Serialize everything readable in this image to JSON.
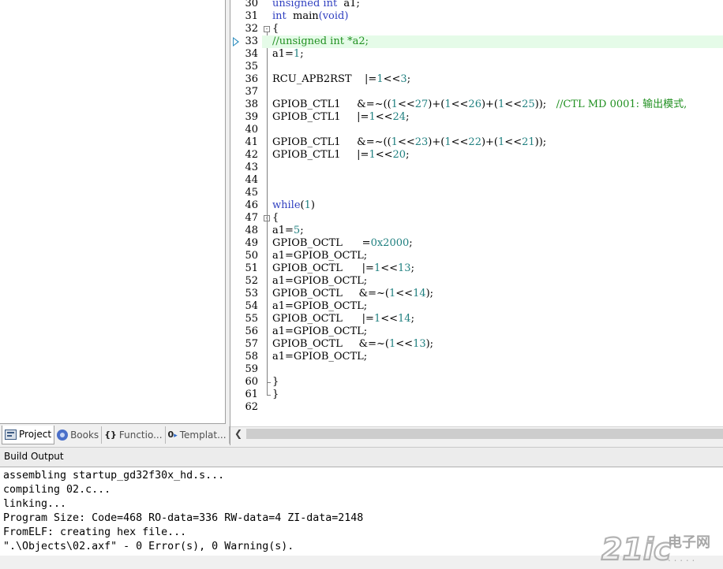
{
  "editor": {
    "lines": [
      {
        "n": "30",
        "segs": [
          [
            "kw",
            "unsigned int"
          ],
          [
            "",
            "  a1;"
          ]
        ]
      },
      {
        "n": "31",
        "segs": [
          [
            "kw",
            "int"
          ],
          [
            "",
            "  main"
          ],
          [
            "kw",
            "(void)"
          ]
        ]
      },
      {
        "n": "32",
        "segs": [
          [
            "",
            "{"
          ]
        ],
        "fold": "open"
      },
      {
        "n": "33",
        "segs": [
          [
            "cm",
            "//unsigned int *a2;"
          ]
        ],
        "highlight": true,
        "marker": true
      },
      {
        "n": "34",
        "segs": [
          [
            "",
            "a1="
          ],
          [
            "num",
            "1"
          ],
          [
            "",
            ";"
          ]
        ]
      },
      {
        "n": "35",
        "segs": []
      },
      {
        "n": "36",
        "segs": [
          [
            "",
            "RCU_APB2RST    |="
          ],
          [
            "num",
            "1"
          ],
          [
            "",
            "<<"
          ],
          [
            "num",
            "3"
          ],
          [
            "",
            ";"
          ]
        ]
      },
      {
        "n": "37",
        "segs": []
      },
      {
        "n": "38",
        "segs": [
          [
            "",
            "GPIOB_CTL1     &=~(("
          ],
          [
            "num",
            "1"
          ],
          [
            "",
            "<<"
          ],
          [
            "num",
            "27"
          ],
          [
            "",
            ")+("
          ],
          [
            "num",
            "1"
          ],
          [
            "",
            "<<"
          ],
          [
            "num",
            "26"
          ],
          [
            "",
            ")+("
          ],
          [
            "num",
            "1"
          ],
          [
            "",
            "<<"
          ],
          [
            "num",
            "25"
          ],
          [
            "",
            "));   "
          ],
          [
            "cm",
            "//CTL MD 0001: 输出模式,"
          ]
        ]
      },
      {
        "n": "39",
        "segs": [
          [
            "",
            "GPIOB_CTL1     |="
          ],
          [
            "num",
            "1"
          ],
          [
            "",
            "<<"
          ],
          [
            "num",
            "24"
          ],
          [
            "",
            ";"
          ]
        ]
      },
      {
        "n": "40",
        "segs": []
      },
      {
        "n": "41",
        "segs": [
          [
            "",
            "GPIOB_CTL1     &=~(("
          ],
          [
            "num",
            "1"
          ],
          [
            "",
            "<<"
          ],
          [
            "num",
            "23"
          ],
          [
            "",
            ")+("
          ],
          [
            "num",
            "1"
          ],
          [
            "",
            "<<"
          ],
          [
            "num",
            "22"
          ],
          [
            "",
            ")+("
          ],
          [
            "num",
            "1"
          ],
          [
            "",
            "<<"
          ],
          [
            "num",
            "21"
          ],
          [
            "",
            "));"
          ]
        ]
      },
      {
        "n": "42",
        "segs": [
          [
            "",
            "GPIOB_CTL1     |="
          ],
          [
            "num",
            "1"
          ],
          [
            "",
            "<<"
          ],
          [
            "num",
            "20"
          ],
          [
            "",
            ";"
          ]
        ]
      },
      {
        "n": "43",
        "segs": []
      },
      {
        "n": "44",
        "segs": []
      },
      {
        "n": "45",
        "segs": []
      },
      {
        "n": "46",
        "segs": [
          [
            "kw",
            "while"
          ],
          [
            "",
            "("
          ],
          [
            "num",
            "1"
          ],
          [
            "",
            ")"
          ]
        ]
      },
      {
        "n": "47",
        "segs": [
          [
            "",
            "{"
          ]
        ],
        "fold": "open"
      },
      {
        "n": "48",
        "segs": [
          [
            "",
            "a1="
          ],
          [
            "num",
            "5"
          ],
          [
            "",
            ";"
          ]
        ]
      },
      {
        "n": "49",
        "segs": [
          [
            "",
            "GPIOB_OCTL      ="
          ],
          [
            "num",
            "0x2000"
          ],
          [
            "",
            ";"
          ]
        ]
      },
      {
        "n": "50",
        "segs": [
          [
            "",
            "a1=GPIOB_OCTL;"
          ]
        ]
      },
      {
        "n": "51",
        "segs": [
          [
            "",
            "GPIOB_OCTL      |="
          ],
          [
            "num",
            "1"
          ],
          [
            "",
            "<<"
          ],
          [
            "num",
            "13"
          ],
          [
            "",
            ";"
          ]
        ]
      },
      {
        "n": "52",
        "segs": [
          [
            "",
            "a1=GPIOB_OCTL;"
          ]
        ]
      },
      {
        "n": "53",
        "segs": [
          [
            "",
            "GPIOB_OCTL     &=~("
          ],
          [
            "num",
            "1"
          ],
          [
            "",
            "<<"
          ],
          [
            "num",
            "14"
          ],
          [
            "",
            ");"
          ]
        ]
      },
      {
        "n": "54",
        "segs": [
          [
            "",
            "a1=GPIOB_OCTL;"
          ]
        ]
      },
      {
        "n": "55",
        "segs": [
          [
            "",
            "GPIOB_OCTL      |="
          ],
          [
            "num",
            "1"
          ],
          [
            "",
            "<<"
          ],
          [
            "num",
            "14"
          ],
          [
            "",
            ";"
          ]
        ]
      },
      {
        "n": "56",
        "segs": [
          [
            "",
            "a1=GPIOB_OCTL;"
          ]
        ]
      },
      {
        "n": "57",
        "segs": [
          [
            "",
            "GPIOB_OCTL     &=~("
          ],
          [
            "num",
            "1"
          ],
          [
            "",
            "<<"
          ],
          [
            "num",
            "13"
          ],
          [
            "",
            ");"
          ]
        ]
      },
      {
        "n": "58",
        "segs": [
          [
            "",
            "a1=GPIOB_OCTL;"
          ]
        ]
      },
      {
        "n": "59",
        "segs": []
      },
      {
        "n": "60",
        "segs": [
          [
            "",
            "}"
          ]
        ],
        "fold": "end"
      },
      {
        "n": "61",
        "segs": [
          [
            "",
            "}"
          ]
        ],
        "fold": "end"
      },
      {
        "n": "62",
        "segs": []
      }
    ]
  },
  "left_tabs": [
    {
      "label": "Project",
      "icon": "project-icon",
      "active": true
    },
    {
      "label": "Books",
      "icon": "books-icon",
      "active": false
    },
    {
      "label": "Functio...",
      "icon": "functions-icon",
      "active": false
    },
    {
      "label": "Templat...",
      "icon": "templates-icon",
      "active": false
    }
  ],
  "build_output": {
    "title": "Build Output",
    "lines": [
      "assembling startup_gd32f30x_hd.s...",
      "compiling 02.c...",
      "linking...",
      "Program Size: Code=468 RO-data=336 RW-data=4 ZI-data=2148",
      "FromELF: creating hex file...",
      "\".\\Objects\\02.axf\" - 0 Error(s), 0 Warning(s)."
    ]
  },
  "watermark": {
    "logo": "21ic",
    "text": "电子网"
  },
  "colors": {
    "keyword": "#3040c0",
    "number": "#208080",
    "comment": "#209020",
    "highlight": "#e5fbe8"
  }
}
